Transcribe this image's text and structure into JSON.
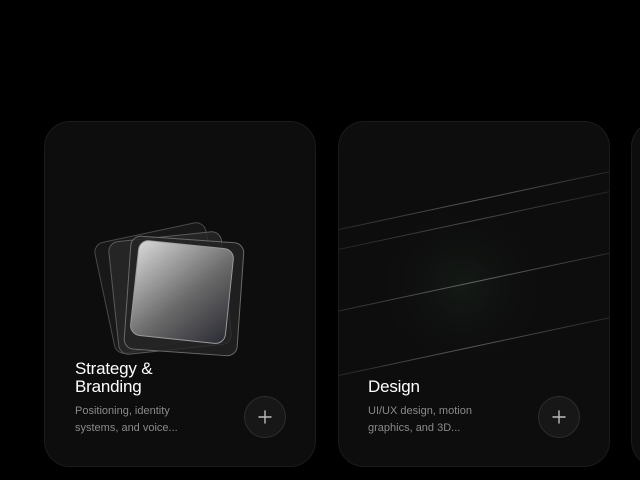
{
  "cards": [
    {
      "title_line1": "Strategy &",
      "title_line2": "Branding",
      "desc_line1": "Positioning, identity",
      "desc_line2": "systems, and voice...",
      "button_icon": "plus-icon",
      "art_icon": "stacked-layers-graphic"
    },
    {
      "title_line1": "Design",
      "title_line2": "",
      "desc_line1": "UI/UX design, motion",
      "desc_line2": "graphics, and 3D...",
      "button_icon": "plus-icon",
      "art_icon": "diagonal-lines-graphic"
    }
  ],
  "colors": {
    "background": "#000000",
    "card": "#0d0d0d",
    "title": "#ffffff",
    "description": "#8a8a8a"
  }
}
